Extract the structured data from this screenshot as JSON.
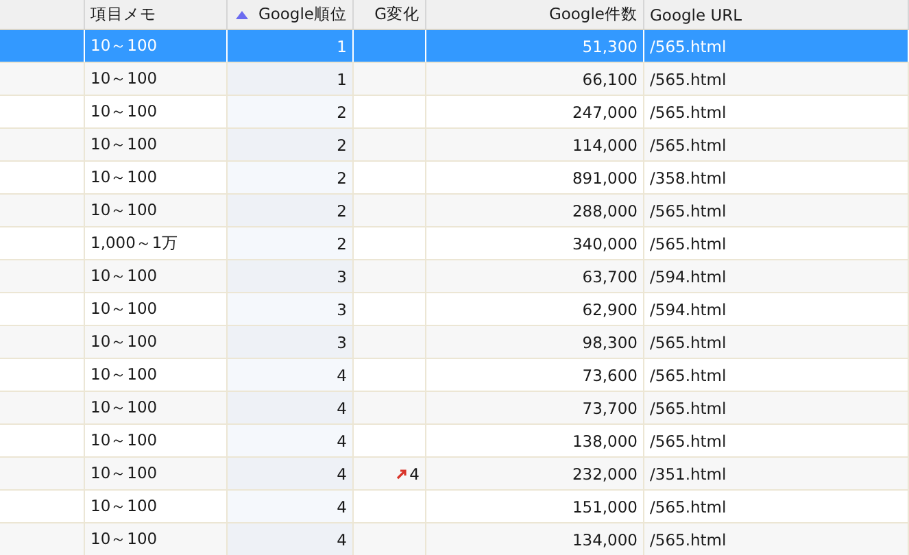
{
  "table": {
    "columns": [
      {
        "label": "項目メモ",
        "right_aligned": false,
        "sorted_ascending": false
      },
      {
        "label": "Google順位",
        "right_aligned": true,
        "sorted_ascending": true
      },
      {
        "label": "G変化",
        "right_aligned": true,
        "sorted_ascending": false
      },
      {
        "label": "Google件数",
        "right_aligned": true,
        "sorted_ascending": false
      },
      {
        "label": "Google URL",
        "right_aligned": false,
        "sorted_ascending": false
      }
    ],
    "rows": [
      {
        "selected": true,
        "cells": [
          "10～100",
          "1",
          "",
          "51,300",
          "/565.html"
        ]
      },
      {
        "selected": false,
        "cells": [
          "10～100",
          "1",
          "",
          "66,100",
          "/565.html"
        ]
      },
      {
        "selected": false,
        "cells": [
          "10～100",
          "2",
          "",
          "247,000",
          "/565.html"
        ]
      },
      {
        "selected": false,
        "cells": [
          "10～100",
          "2",
          "",
          "114,000",
          "/565.html"
        ]
      },
      {
        "selected": false,
        "cells": [
          "10～100",
          "2",
          "",
          "891,000",
          "/358.html"
        ]
      },
      {
        "selected": false,
        "cells": [
          "10～100",
          "2",
          "",
          "288,000",
          "/565.html"
        ]
      },
      {
        "selected": false,
        "cells": [
          "1,000～1万",
          "2",
          "",
          "340,000",
          "/565.html"
        ]
      },
      {
        "selected": false,
        "cells": [
          "10～100",
          "3",
          "",
          "63,700",
          "/594.html"
        ]
      },
      {
        "selected": false,
        "cells": [
          "10～100",
          "3",
          "",
          "62,900",
          "/594.html"
        ]
      },
      {
        "selected": false,
        "cells": [
          "10～100",
          "3",
          "",
          "98,300",
          "/565.html"
        ]
      },
      {
        "selected": false,
        "cells": [
          "10～100",
          "4",
          "",
          "73,600",
          "/565.html"
        ]
      },
      {
        "selected": false,
        "cells": [
          "10～100",
          "4",
          "",
          "73,700",
          "/565.html"
        ]
      },
      {
        "selected": false,
        "cells": [
          "10～100",
          "4",
          "",
          "138,000",
          "/565.html"
        ]
      },
      {
        "selected": false,
        "cells": [
          "10～100",
          "4",
          "4",
          "232,000",
          "/351.html"
        ],
        "change_up": true
      },
      {
        "selected": false,
        "cells": [
          "10～100",
          "4",
          "",
          "151,000",
          "/565.html"
        ]
      },
      {
        "selected": false,
        "cells": [
          "10～100",
          "4",
          "",
          "134,000",
          "/565.html"
        ]
      }
    ]
  }
}
